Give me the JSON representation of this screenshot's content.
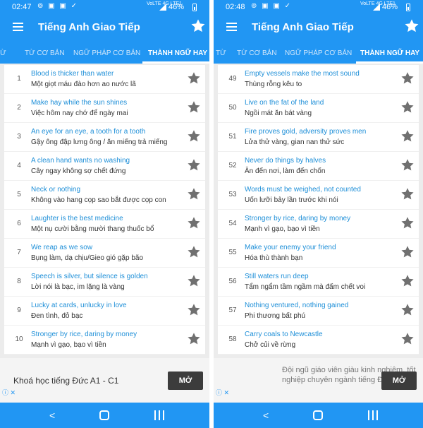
{
  "colors": {
    "primary": "#2196f3",
    "link_text": "#1e8fd8",
    "star": "#707070"
  },
  "app_title": "Tiếng Anh Giao Tiếp",
  "tabs": [
    "TỪ",
    "TỪ CƠ BẢN",
    "NGỮ PHÁP CƠ BẢN",
    "THÀNH NGỮ HAY"
  ],
  "active_tab": "THÀNH NGỮ HAY",
  "icons": {
    "menu": "hamburger-menu-icon",
    "favorite": "star-icon",
    "back": "back-icon",
    "home": "home-icon",
    "recents": "recents-icon"
  },
  "nav": {
    "back_glyph": "<"
  },
  "left": {
    "status": {
      "time": "02:47",
      "icons": "⊚ ▣ ▣ ✓",
      "network": "VoLTE 4G LTE1",
      "battery": "46%"
    },
    "rows": [
      {
        "num": "1",
        "en": "Blood is thicker than water",
        "vi": "Một giọt máu đào hơn ao nước lã"
      },
      {
        "num": "2",
        "en": "Make hay while the sun shines",
        "vi": "Việc hôm nay chớ để ngày mai"
      },
      {
        "num": "3",
        "en": "An eye for an eye, a tooth for a tooth",
        "vi": "Gậy ông đập lưng ông / ăn miếng trả miếng"
      },
      {
        "num": "4",
        "en": "A clean hand wants no washing",
        "vi": "Cây ngay không sợ chết đứng"
      },
      {
        "num": "5",
        "en": "Neck or nothing",
        "vi": "Không vào hang cọp sao bắt được cọp con"
      },
      {
        "num": "6",
        "en": "Laughter is the best medicine",
        "vi": "Một nụ cười bằng mười thang thuốc bổ"
      },
      {
        "num": "7",
        "en": "We reap as we sow",
        "vi": "Bụng làm, dạ chịu/Gieo gió gặp bão"
      },
      {
        "num": "8",
        "en": "Speech is silver, but silence is golden",
        "vi": "Lời nói là bạc, im lặng là vàng"
      },
      {
        "num": "9",
        "en": "Lucky at cards, unlucky in love",
        "vi": "Đen tình, đỏ bạc"
      },
      {
        "num": "10",
        "en": "Stronger by rice, daring by money",
        "vi": "Mạnh vì gạo, bạo vì tiền"
      }
    ],
    "ad": {
      "text": "Khoá học tiếng Đức A1 - C1",
      "button": "MỞ",
      "info": "ⓘ ✕"
    }
  },
  "right": {
    "status": {
      "time": "02:48",
      "icons": "⊚ ▣ ▣ ✓",
      "network": "VoLTE 4G LTE1",
      "battery": "46%"
    },
    "rows": [
      {
        "num": "49",
        "en": "Empty vessels make the most sound",
        "vi": "Thùng rỗng kêu to"
      },
      {
        "num": "50",
        "en": "Live on the fat of the land",
        "vi": "Ngồi mát ăn bát vàng"
      },
      {
        "num": "51",
        "en": "Fire proves gold, adversity proves men",
        "vi": "Lửa thử vàng, gian nan thử sức"
      },
      {
        "num": "52",
        "en": "Never do things by halves",
        "vi": "Ăn đến nơi, làm đến chốn"
      },
      {
        "num": "53",
        "en": "Words must be weighed, not counted",
        "vi": "Uốn lưỡi bảy lần trước khi nói"
      },
      {
        "num": "54",
        "en": "Stronger by rice, daring by money",
        "vi": "Mạnh vì gạo, bạo vì tiền"
      },
      {
        "num": "55",
        "en": "Make your enemy your friend",
        "vi": "Hóa thù thành bạn"
      },
      {
        "num": "56",
        "en": "Still waters run deep",
        "vi": "Tẩm ngẩm tầm ngầm mà đấm chết voi"
      },
      {
        "num": "57",
        "en": "Nothing ventured, nothing gained",
        "vi": "Phi thương bất phú"
      },
      {
        "num": "58",
        "en": "Carry coals to Newcastle",
        "vi": "Chở củi về rừng"
      }
    ],
    "ad": {
      "text": "Đội ngũ giáo viên giàu kinh nghiệm, tốt nghiệp chuyên ngành tiếng Đức.",
      "button": "MỞ",
      "info": "ⓘ ✕"
    }
  }
}
